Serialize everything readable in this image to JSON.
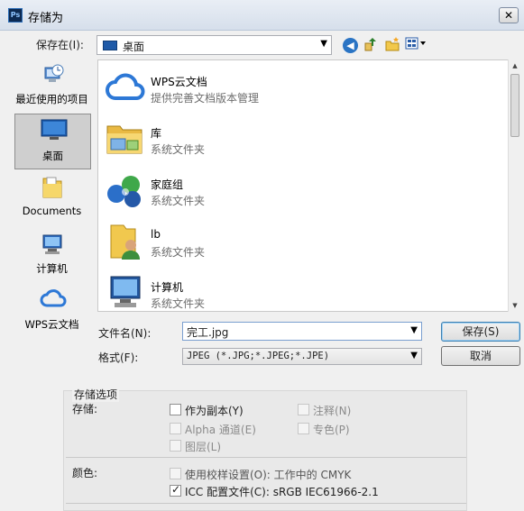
{
  "window": {
    "title": "存储为",
    "app_icon": "Ps",
    "close": "✕"
  },
  "location": {
    "label": "保存在(I):",
    "value": "桌面"
  },
  "places": [
    {
      "label": "最近使用的项目",
      "icon": "recent-icon"
    },
    {
      "label": "桌面",
      "icon": "desktop-icon",
      "selected": true
    },
    {
      "label": "Documents",
      "icon": "documents-folder-icon"
    },
    {
      "label": "计算机",
      "icon": "computer-icon"
    },
    {
      "label": "WPS云文档",
      "icon": "cloud-icon"
    }
  ],
  "files": [
    {
      "name": "WPS云文档",
      "desc": "提供完善文档版本管理",
      "icon": "cloud-icon"
    },
    {
      "name": "库",
      "desc": "系统文件夹",
      "icon": "library-folder-icon"
    },
    {
      "name": "家庭组",
      "desc": "系统文件夹",
      "icon": "homegroup-icon"
    },
    {
      "name": "lb",
      "desc": "系统文件夹",
      "icon": "user-folder-icon"
    },
    {
      "name": "计算机",
      "desc": "系统文件夹",
      "icon": "computer-icon"
    }
  ],
  "form": {
    "filename_label": "文件名(N):",
    "filename_value": "完工.jpg",
    "format_label": "格式(F):",
    "format_value": "JPEG (*.JPG;*.JPEG;*.JPE)",
    "save_button": "保存(S)",
    "cancel_button": "取消"
  },
  "options": {
    "section_title": "存储选项",
    "store_label": "存储:",
    "as_copy": {
      "label": "作为副本(Y)",
      "checked": false,
      "enabled": true
    },
    "notes": {
      "label": "注释(N)",
      "checked": false,
      "enabled": false
    },
    "alpha": {
      "label": "Alpha 通道(E)",
      "checked": false,
      "enabled": false
    },
    "spot": {
      "label": "专色(P)",
      "checked": false,
      "enabled": false
    },
    "layers": {
      "label": "图层(L)",
      "checked": false,
      "enabled": false
    },
    "color_label": "颜色:",
    "proof": {
      "label": "使用校样设置(O):  工作中的 CMYK",
      "checked": false,
      "enabled": false
    },
    "icc": {
      "label": "ICC 配置文件(C):  sRGB IEC61966-2.1",
      "checked": true,
      "enabled": true
    }
  }
}
